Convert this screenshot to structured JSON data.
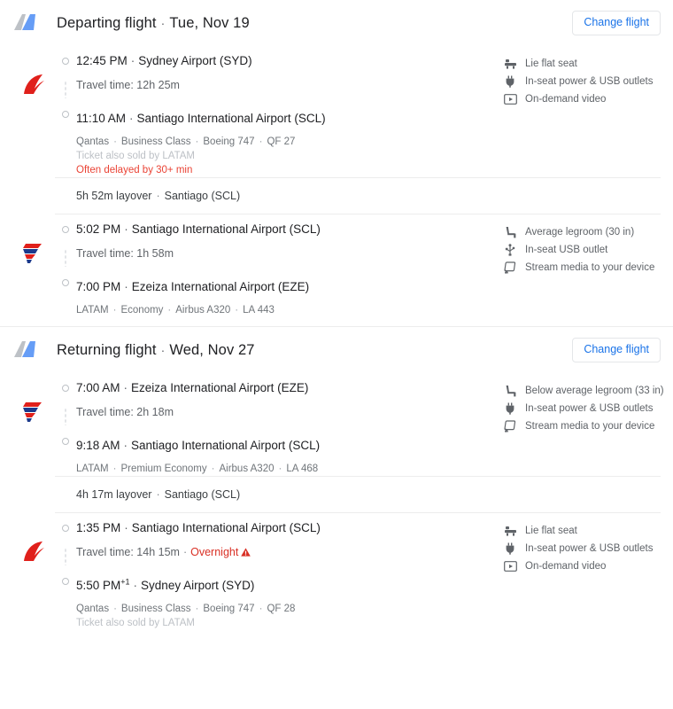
{
  "sections": [
    {
      "id": "departing",
      "icon": "airplane-tail-icon",
      "title": "Departing flight",
      "separator": "·",
      "date": "Tue, Nov 19",
      "change_label": "Change flight",
      "legs": [
        {
          "airline_logo": "qantas-logo",
          "depart_time": "12:45 PM",
          "depart_sep": "·",
          "depart_place": "Sydney Airport (SYD)",
          "depart_suffix": "",
          "duration": "Travel time: 12h 25m",
          "overnight": "",
          "arrive_time": "11:10 AM",
          "arrive_sep": "·",
          "arrive_place": "Santiago International Airport (SCL)",
          "arrive_suffix": "",
          "operator": "Qantas",
          "cabin": "Business Class",
          "aircraft": "Boeing 747",
          "flight_no": "QF 27",
          "codeshare": "Ticket also sold by LATAM",
          "alert": "Often delayed by 30+ min",
          "amenities": [
            {
              "icon": "lie-flat-seat-icon",
              "label": "Lie flat seat"
            },
            {
              "icon": "power-outlet-icon",
              "label": "In-seat power & USB outlets"
            },
            {
              "icon": "on-demand-video-icon",
              "label": "On-demand video"
            }
          ]
        },
        {
          "airline_logo": "latam-logo",
          "depart_time": "5:02 PM",
          "depart_sep": "·",
          "depart_place": "Santiago International Airport (SCL)",
          "depart_suffix": "",
          "duration": "Travel time: 1h 58m",
          "overnight": "",
          "arrive_time": "7:00 PM",
          "arrive_sep": "·",
          "arrive_place": "Ezeiza International Airport (EZE)",
          "arrive_suffix": "",
          "operator": "LATAM",
          "cabin": "Economy",
          "aircraft": "Airbus A320",
          "flight_no": "LA 443",
          "codeshare": "",
          "alert": "",
          "amenities": [
            {
              "icon": "legroom-icon",
              "label": "Average legroom (30 in)"
            },
            {
              "icon": "usb-icon",
              "label": "In-seat USB outlet"
            },
            {
              "icon": "stream-media-icon",
              "label": "Stream media to your device"
            }
          ]
        }
      ],
      "layovers": [
        {
          "after_leg": 0,
          "duration": "5h 52m layover",
          "sep": "·",
          "place": "Santiago (SCL)"
        }
      ]
    },
    {
      "id": "returning",
      "icon": "airplane-tail-icon",
      "title": "Returning flight",
      "separator": "·",
      "date": "Wed, Nov 27",
      "change_label": "Change flight",
      "legs": [
        {
          "airline_logo": "latam-logo",
          "depart_time": "7:00 AM",
          "depart_sep": "·",
          "depart_place": "Ezeiza International Airport (EZE)",
          "depart_suffix": "",
          "duration": "Travel time: 2h 18m",
          "overnight": "",
          "arrive_time": "9:18 AM",
          "arrive_sep": "·",
          "arrive_place": "Santiago International Airport (SCL)",
          "arrive_suffix": "",
          "operator": "LATAM",
          "cabin": "Premium Economy",
          "aircraft": "Airbus A320",
          "flight_no": "LA 468",
          "codeshare": "",
          "alert": "",
          "amenities": [
            {
              "icon": "legroom-icon",
              "label": "Below average legroom (33 in)"
            },
            {
              "icon": "power-outlet-icon",
              "label": "In-seat power & USB outlets"
            },
            {
              "icon": "stream-media-icon",
              "label": "Stream media to your device"
            }
          ]
        },
        {
          "airline_logo": "qantas-logo",
          "depart_time": "1:35 PM",
          "depart_sep": "·",
          "depart_place": "Santiago International Airport (SCL)",
          "depart_suffix": "",
          "duration": "Travel time: 14h 15m",
          "duration_sep": "·",
          "overnight": "Overnight",
          "arrive_time": "5:50 PM",
          "arrive_suffix": "+1",
          "arrive_sep": "·",
          "arrive_place": "Sydney Airport (SYD)",
          "operator": "Qantas",
          "cabin": "Business Class",
          "aircraft": "Boeing 747",
          "flight_no": "QF 28",
          "codeshare": "Ticket also sold by LATAM",
          "alert": "",
          "amenities": [
            {
              "icon": "lie-flat-seat-icon",
              "label": "Lie flat seat"
            },
            {
              "icon": "power-outlet-icon",
              "label": "In-seat power & USB outlets"
            },
            {
              "icon": "on-demand-video-icon",
              "label": "On-demand video"
            }
          ]
        }
      ],
      "layovers": [
        {
          "after_leg": 0,
          "duration": "4h 17m layover",
          "sep": "·",
          "place": "Santiago (SCL)"
        }
      ]
    }
  ],
  "colors": {
    "link": "#1a73e8",
    "alert_red": "#ea4335",
    "warning_red": "#d93025",
    "text_primary": "#202124",
    "text_secondary": "#5f6368",
    "divider": "#ededed"
  }
}
